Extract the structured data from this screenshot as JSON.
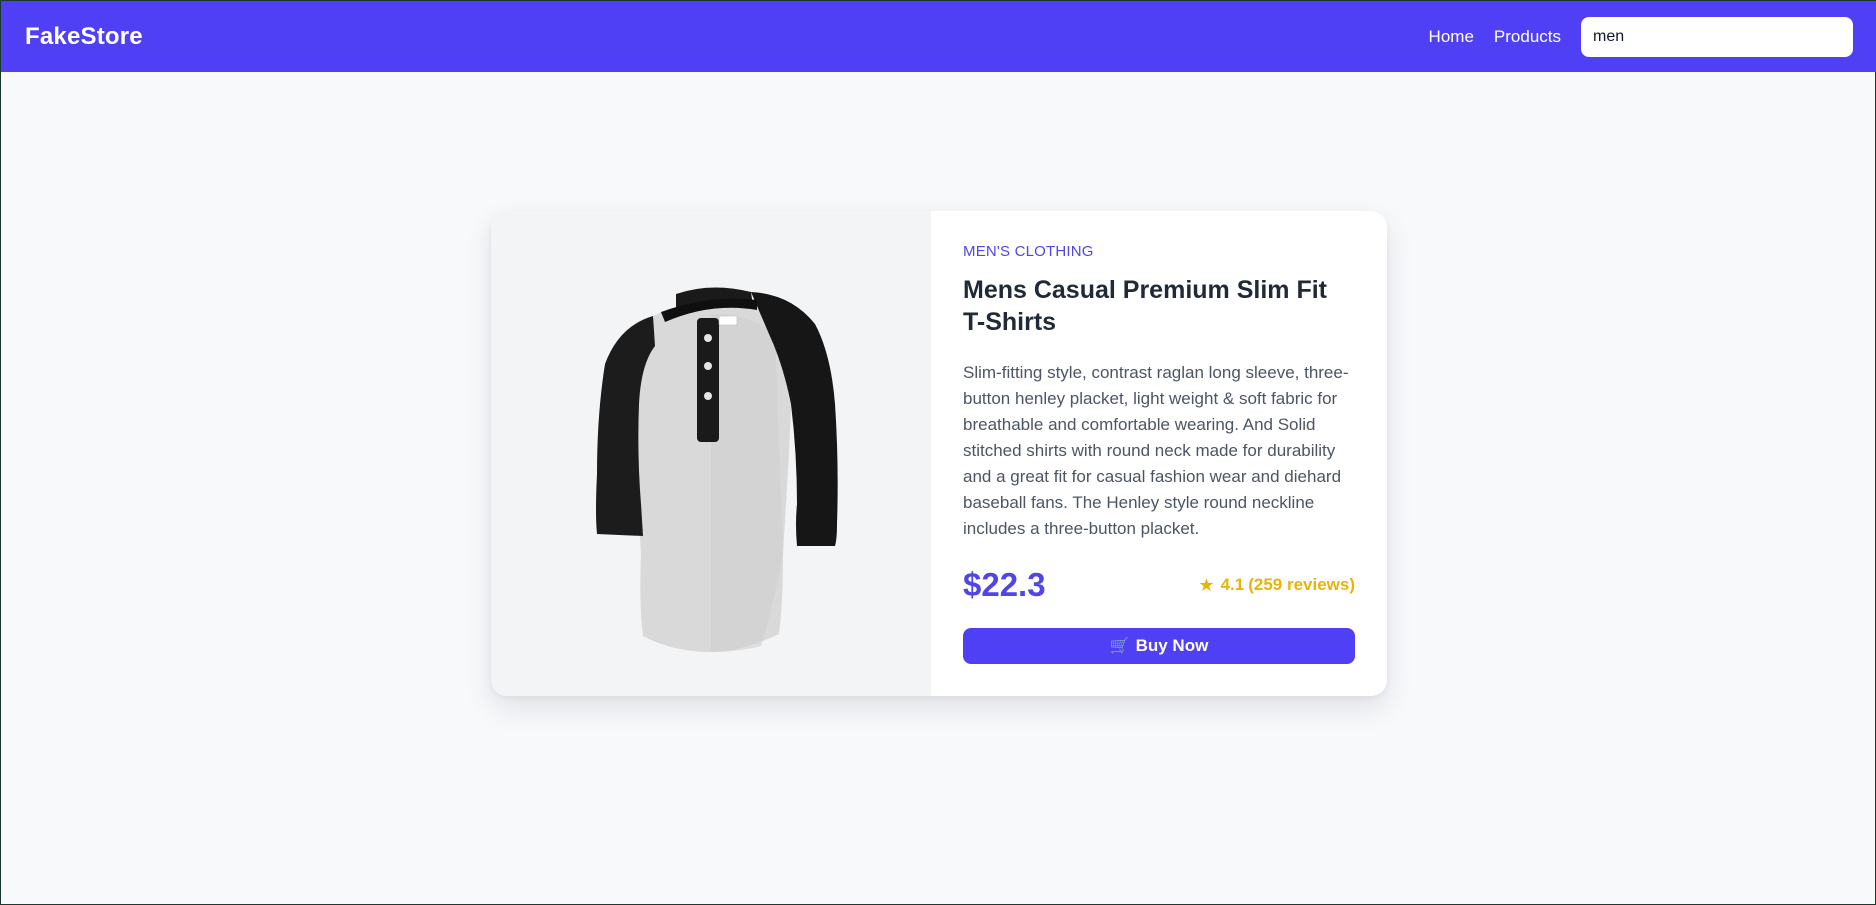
{
  "header": {
    "brand": "FakeStore",
    "nav": [
      {
        "label": "Home"
      },
      {
        "label": "Products"
      }
    ],
    "search": {
      "value": "men",
      "placeholder": ""
    },
    "accent_color": "#4f3ff5"
  },
  "product": {
    "category": "MEN'S CLOTHING",
    "title": "Mens Casual Premium Slim Fit T-Shirts",
    "description": "Slim-fitting style, contrast raglan long sleeve, three-button henley placket, light weight & soft fabric for breathable and comfortable wearing. And Solid stitched shirts with round neck made for durability and a great fit for casual fashion wear and diehard baseball fans. The Henley style round neckline includes a three-button placket.",
    "price": "$22.3",
    "rating": {
      "icon": "star-icon",
      "value": "4.1",
      "reviews": "(259 reviews)",
      "color": "#eab308"
    },
    "buy": {
      "icon": "cart-icon",
      "label": "Buy Now"
    },
    "image_icon": "henley-tshirt-image"
  }
}
